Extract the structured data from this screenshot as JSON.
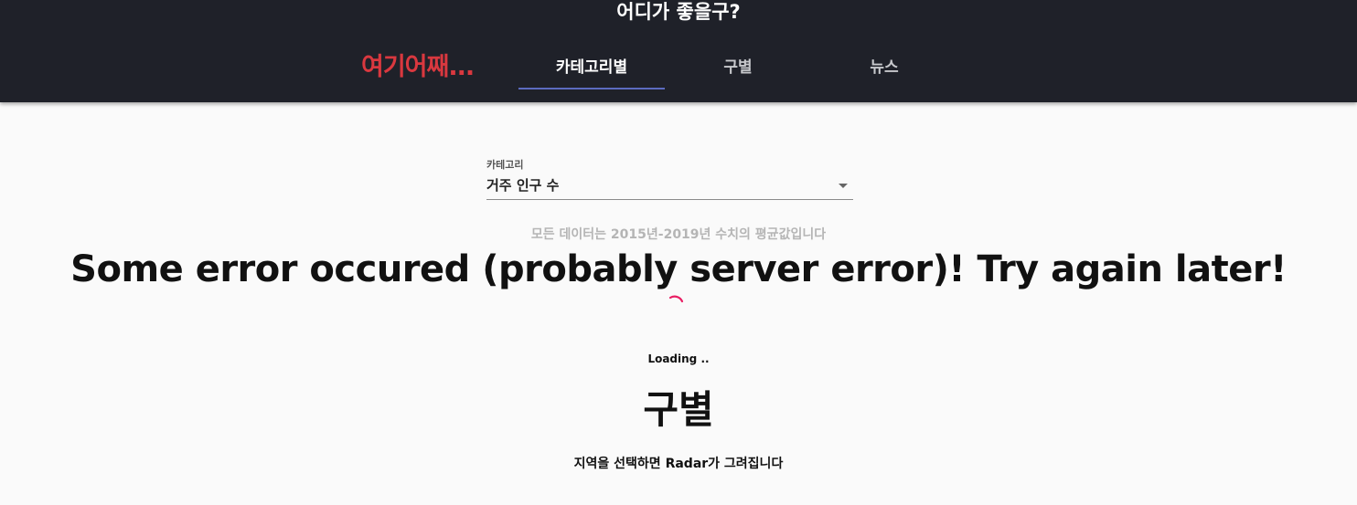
{
  "header": {
    "site_title": "어디가 좋을구?",
    "brand": "여기어째...",
    "tabs": [
      {
        "label": "카테고리별",
        "active": true
      },
      {
        "label": "구별",
        "active": false
      },
      {
        "label": "뉴스",
        "active": false
      }
    ]
  },
  "category_select": {
    "label": "카테고리",
    "value": "거주 인구 수"
  },
  "data_note": "모든 데이터는 2015년-2019년 수치의 평균값입니다",
  "error_message": "Some error occured (probably server error)! Try again later!",
  "loading_text": "Loading ..",
  "district_section": {
    "title": "구별",
    "hint": "지역을 선택하면 Radar가 그려집니다"
  },
  "colors": {
    "appbar_bg": "#1f2129",
    "brand": "#d9383f",
    "tab_indicator": "#5c6bc0",
    "spinner": "#e91e63"
  },
  "icons": {
    "select_arrow": "caret-down-icon",
    "spinner": "loading-spinner-icon"
  }
}
